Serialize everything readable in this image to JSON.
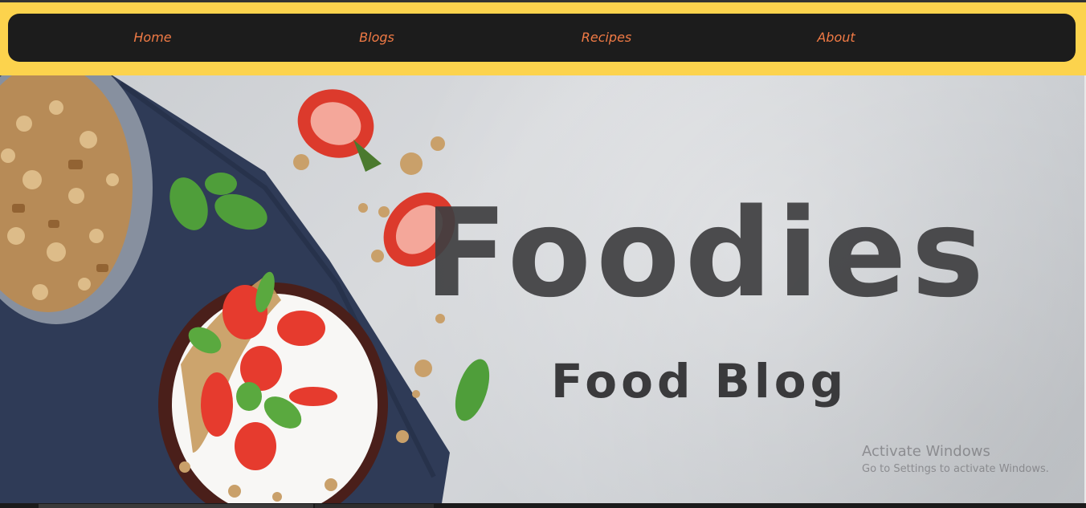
{
  "nav": {
    "items": [
      {
        "label": "Home"
      },
      {
        "label": "Blogs"
      },
      {
        "label": "Recipes"
      },
      {
        "label": "About"
      }
    ]
  },
  "hero": {
    "title": "Foodies",
    "subtitle": "Food Blog"
  },
  "watermark": {
    "title": "Activate Windows",
    "subtitle": "Go to Settings to activate Windows."
  },
  "colors": {
    "band": "#fcd34d",
    "navbar": "#1c1c1c",
    "nav_link": "#f07a45",
    "hero_text": "#3f3f41"
  }
}
